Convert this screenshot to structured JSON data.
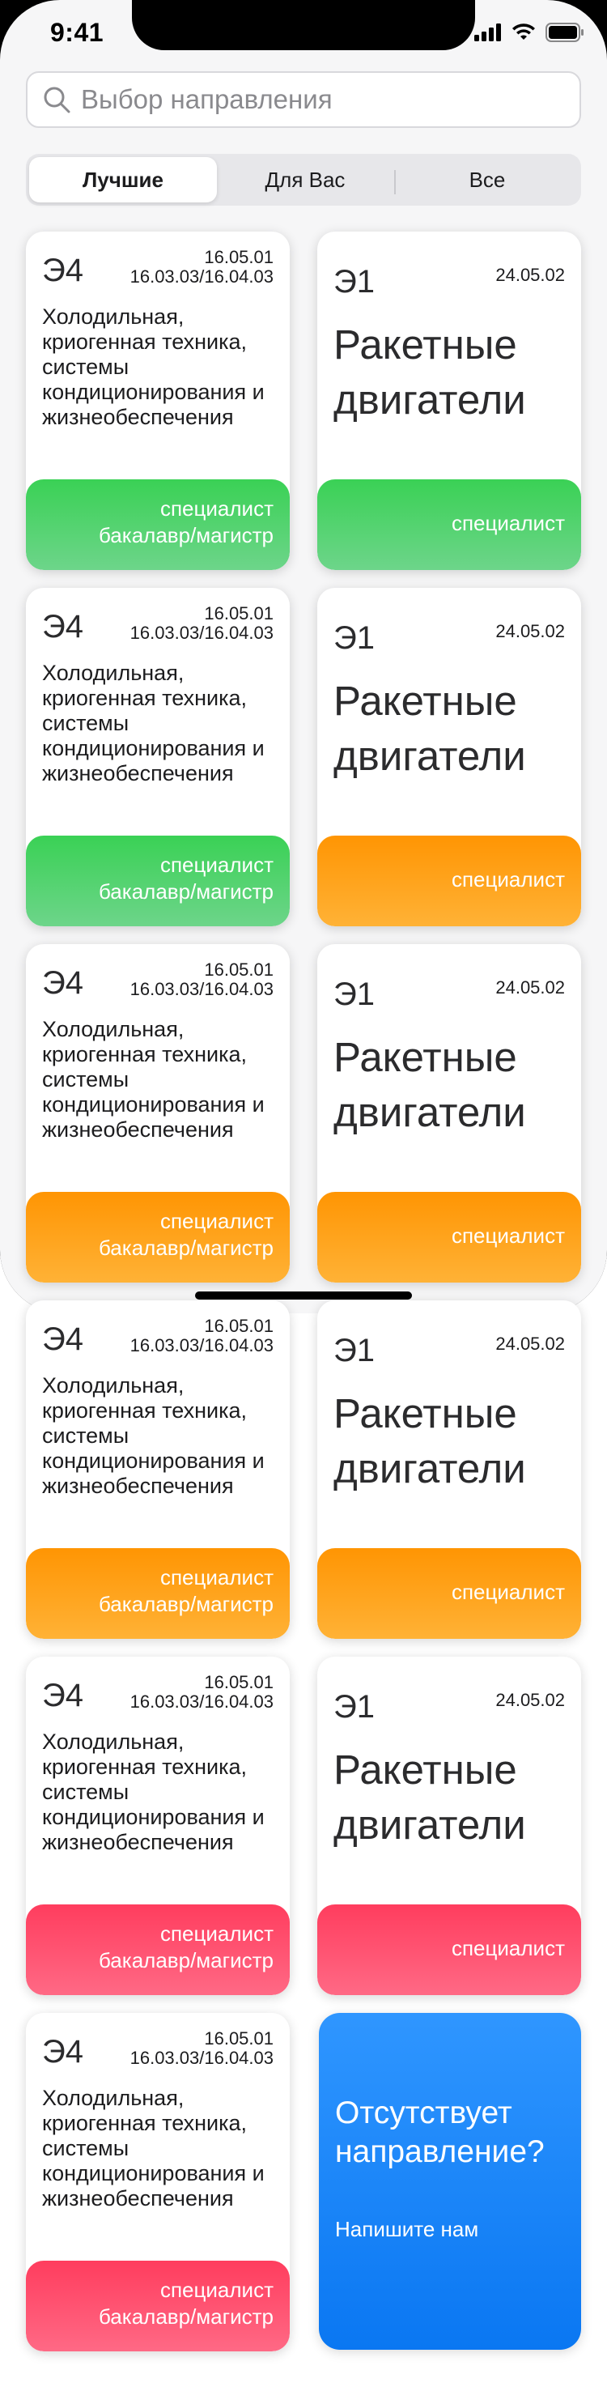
{
  "status": {
    "time": "9:41"
  },
  "search": {
    "placeholder": "Выбор направления"
  },
  "tabs": {
    "best": "Лучшие",
    "for_you": "Для Вас",
    "all": "Все"
  },
  "cards": [
    {
      "code": "Э4",
      "codes_line1": "16.05.01",
      "codes_line2": "16.03.03/16.04.03",
      "description": "Холодильная, криогенная техника, системы кондиционирования и жизнеобеспечения",
      "degree_line1": "специалист",
      "degree_line2": "бакалавр/магистр"
    },
    {
      "code": "Э1",
      "codes_line1": "24.05.02",
      "title": "Ракетные двигатели",
      "degree_line1": "специалист"
    },
    {
      "code": "Э4",
      "codes_line1": "16.05.01",
      "codes_line2": "16.03.03/16.04.03",
      "description": "Холодильная, криогенная техника, системы кондиционирования и жизнеобеспечения",
      "degree_line1": "специалист",
      "degree_line2": "бакалавр/магистр"
    },
    {
      "code": "Э1",
      "codes_line1": "24.05.02",
      "title": "Ракетные двигатели",
      "degree_line1": "специалист"
    },
    {
      "code": "Э4",
      "codes_line1": "16.05.01",
      "codes_line2": "16.03.03/16.04.03",
      "description": "Холодильная, криогенная техника, системы кондиционирования и жизнеобеспечения",
      "degree_line1": "специалист",
      "degree_line2": "бакалавр/магистр"
    },
    {
      "code": "Э1",
      "codes_line1": "24.05.02",
      "title": "Ракетные двигатели",
      "degree_line1": "специалист"
    },
    {
      "code": "Э4",
      "codes_line1": "16.05.01",
      "codes_line2": "16.03.03/16.04.03",
      "description": "Холодильная, криогенная техника, системы кондиционирования и жизнеобеспечения",
      "degree_line1": "специалист",
      "degree_line2": "бакалавр/магистр"
    },
    {
      "code": "Э1",
      "codes_line1": "24.05.02",
      "title": "Ракетные двигатели",
      "degree_line1": "специалист"
    },
    {
      "code": "Э4",
      "codes_line1": "16.05.01",
      "codes_line2": "16.03.03/16.04.03",
      "description": "Холодильная, криогенная техника, системы кондиционирования и жизнеобеспечения",
      "degree_line1": "специалист",
      "degree_line2": "бакалавр/магистр"
    },
    {
      "code": "Э1",
      "codes_line1": "24.05.02",
      "title": "Ракетные двигатели",
      "degree_line1": "специалист"
    },
    {
      "code": "Э4",
      "codes_line1": "16.05.01",
      "codes_line2": "16.03.03/16.04.03",
      "description": "Холодильная, криогенная техника, системы кондиционирования и жизнеобеспечения",
      "degree_line1": "специалист",
      "degree_line2": "бакалавр/магистр"
    }
  ],
  "promo": {
    "title": "Отсутствует направление?",
    "link": "Напишите нам"
  },
  "colors": {
    "green": "#3ad155",
    "orange": "#ff9503",
    "red": "#ff3d5e",
    "blue": "#0a77f2"
  }
}
